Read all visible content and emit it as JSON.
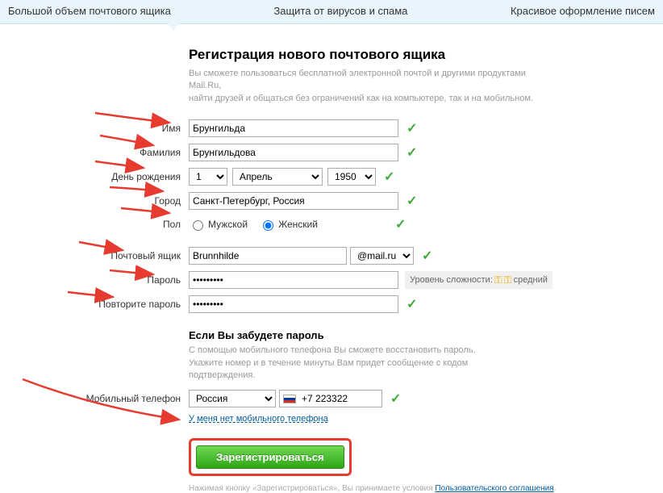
{
  "topbar": {
    "left": "Большой объем почтового ящика",
    "center": "Защита от вирусов и спама",
    "right": "Красивое оформление писем"
  },
  "heading": "Регистрация нового почтового ящика",
  "description1": "Вы сможете пользоваться бесплатной электронной почтой и другими продуктами Mail.Ru,",
  "description2": "найти друзей и общаться без ограничений как на компьютере, так и на мобильном.",
  "labels": {
    "firstname": "Имя",
    "lastname": "Фамилия",
    "birthday": "День рождения",
    "city": "Город",
    "gender": "Пол",
    "mailbox": "Почтовый ящик",
    "password": "Пароль",
    "password2": "Повторите пароль",
    "phone": "Мобильный телефон"
  },
  "values": {
    "firstname": "Брунгильда",
    "lastname": "Брунгильдова",
    "day": "1",
    "month": "Апрель",
    "year": "1950",
    "city": "Санкт-Петербург, Россия",
    "mailbox": "Brunnhilde",
    "domain": "@mail.ru",
    "password": "•••••••••",
    "password2": "•••••••••",
    "country": "Россия",
    "phone": "+7 223322"
  },
  "gender": {
    "male": "Мужской",
    "female": "Женский"
  },
  "strength": {
    "label": "Уровень сложности:",
    "level": "средний"
  },
  "recovery": {
    "heading": "Если Вы забудете пароль",
    "line1": "С помощью мобильного телефона Вы сможете восстановить пароль.",
    "line2": "Укажите номер и в течение минуты Вам придет сообщение с кодом подтверждения.",
    "no_phone": "У меня нет мобильного телефона"
  },
  "register_button": "Зарегистрироваться",
  "footnote": {
    "pre": "Нажимая кнопку «Зарегистрироваться», Вы принимаете условия ",
    "link": "Пользовательского соглашения",
    "post": "."
  }
}
